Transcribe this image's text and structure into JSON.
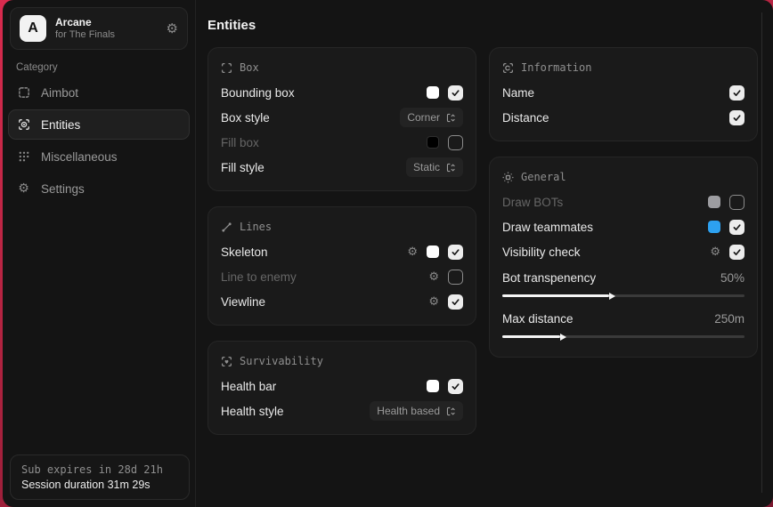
{
  "app": {
    "logo_letter": "A",
    "name": "Arcane",
    "subtitle": "for The Finals"
  },
  "sidebar": {
    "category_label": "Category",
    "items": [
      {
        "id": "aimbot",
        "label": "Aimbot",
        "icon": "dashed-box-icon",
        "active": false
      },
      {
        "id": "entities",
        "label": "Entities",
        "icon": "scan-eye-icon",
        "active": true
      },
      {
        "id": "miscellaneous",
        "label": "Miscellaneous",
        "icon": "grid-dots-icon",
        "active": false
      },
      {
        "id": "settings",
        "label": "Settings",
        "icon": "gear-icon",
        "active": false
      }
    ],
    "footer": {
      "line1": "Sub expires in 28d 21h",
      "line2": "Session duration 31m 29s"
    }
  },
  "main": {
    "title": "Entities",
    "columns": [
      [
        {
          "id": "box",
          "icon": "box-corners-icon",
          "title": "Box",
          "rows": [
            {
              "label": "Bounding box",
              "controls": [
                {
                  "kind": "swatch",
                  "color": "#ffffff"
                },
                {
                  "kind": "checkbox",
                  "checked": true
                }
              ]
            },
            {
              "label": "Box style",
              "controls": [
                {
                  "kind": "dropdown",
                  "value": "Corner"
                }
              ]
            },
            {
              "label": "Fill box",
              "dim": true,
              "controls": [
                {
                  "kind": "swatch",
                  "color": "#000000"
                },
                {
                  "kind": "checkbox",
                  "checked": false
                }
              ]
            },
            {
              "label": "Fill style",
              "controls": [
                {
                  "kind": "dropdown",
                  "value": "Static"
                }
              ]
            }
          ]
        },
        {
          "id": "lines",
          "icon": "line-icon",
          "title": "Lines",
          "rows": [
            {
              "label": "Skeleton",
              "controls": [
                {
                  "kind": "gear"
                },
                {
                  "kind": "swatch",
                  "color": "#ffffff"
                },
                {
                  "kind": "checkbox",
                  "checked": true
                }
              ]
            },
            {
              "label": "Line to enemy",
              "dim": true,
              "controls": [
                {
                  "kind": "gear"
                },
                {
                  "kind": "checkbox",
                  "checked": false
                }
              ]
            },
            {
              "label": "Viewline",
              "controls": [
                {
                  "kind": "gear"
                },
                {
                  "kind": "checkbox",
                  "checked": true
                }
              ]
            }
          ]
        },
        {
          "id": "survivability",
          "icon": "heart-scan-icon",
          "title": "Survivability",
          "rows": [
            {
              "label": "Health bar",
              "controls": [
                {
                  "kind": "swatch",
                  "color": "#ffffff"
                },
                {
                  "kind": "checkbox",
                  "checked": true
                }
              ]
            },
            {
              "label": "Health style",
              "controls": [
                {
                  "kind": "dropdown",
                  "value": "Health based"
                }
              ]
            }
          ]
        }
      ],
      [
        {
          "id": "information",
          "icon": "info-scan-icon",
          "title": "Information",
          "rows": [
            {
              "label": "Name",
              "controls": [
                {
                  "kind": "checkbox",
                  "checked": true
                }
              ]
            },
            {
              "label": "Distance",
              "controls": [
                {
                  "kind": "checkbox",
                  "checked": true
                }
              ]
            }
          ]
        },
        {
          "id": "general",
          "icon": "focus-icon",
          "title": "General",
          "rows": [
            {
              "label": "Draw BOTs",
              "dim": true,
              "controls": [
                {
                  "kind": "swatch",
                  "color": "#9d9da1"
                },
                {
                  "kind": "checkbox",
                  "checked": false
                }
              ]
            },
            {
              "label": "Draw teammates",
              "controls": [
                {
                  "kind": "swatch",
                  "color": "#2da1f0"
                },
                {
                  "kind": "checkbox",
                  "checked": true
                }
              ]
            },
            {
              "label": "Visibility check",
              "controls": [
                {
                  "kind": "gear"
                },
                {
                  "kind": "checkbox",
                  "checked": true
                }
              ]
            },
            {
              "type": "slider",
              "label": "Bot transpenency",
              "value": "50%",
              "fraction": 0.44
            },
            {
              "type": "slider",
              "label": "Max distance",
              "value": "250m",
              "fraction": 0.24
            }
          ]
        }
      ]
    ]
  },
  "colors": {
    "background_red": "#d82b4e",
    "window_bg": "#141414",
    "card_bg": "#1a1a1a",
    "accent_blue": "#2da1f0",
    "checkbox_checked": "#ececec"
  }
}
